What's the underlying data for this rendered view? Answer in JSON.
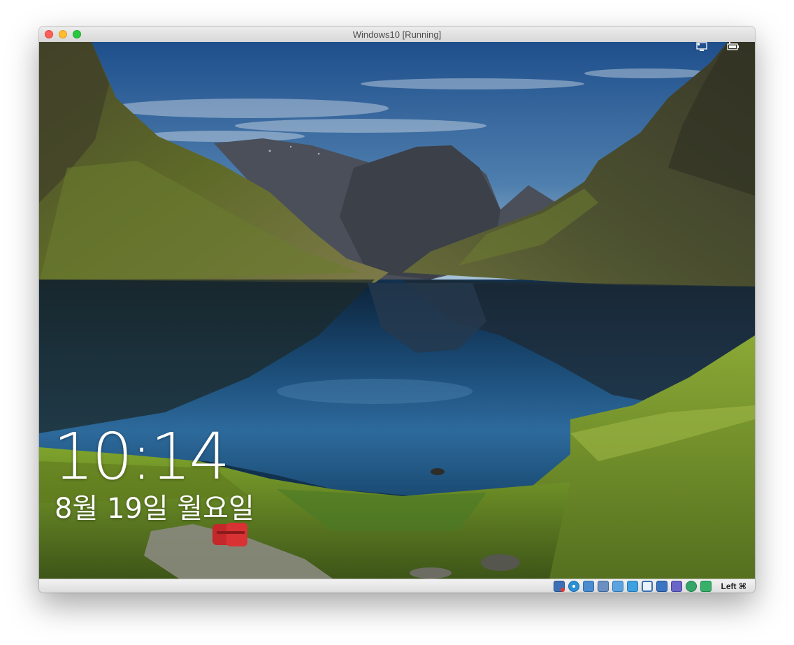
{
  "window": {
    "title": "Windows10 [Running]"
  },
  "lock_screen": {
    "time": "10:14",
    "date": "8월 19일 월요일",
    "icons": [
      "network-icon",
      "battery-icon"
    ]
  },
  "status_bar": {
    "icons": [
      "hard-disk-icon",
      "optical-drive-icon",
      "audio-icon",
      "network-adapter-icon",
      "usb-icon",
      "shared-folders-icon",
      "display-icon",
      "video-capture-icon",
      "cpu-icon",
      "mouse-integration-icon",
      "keyboard-capture-icon"
    ],
    "host_key": "Left ⌘"
  },
  "colors": {
    "sky": "#2a5a8c",
    "lake": "#1f4e78",
    "grass": "#6b8f24",
    "cliff": "#3e3e2a"
  }
}
